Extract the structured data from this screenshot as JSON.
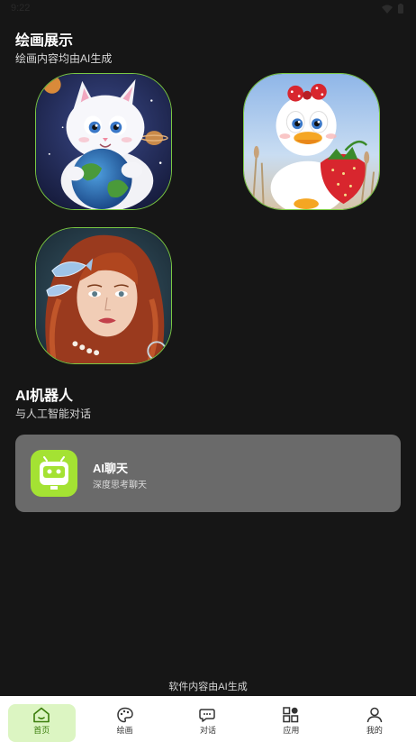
{
  "status": {
    "time": "9:22"
  },
  "gallery": {
    "title": "绘画展示",
    "subtitle": "绘画内容均由AI生成",
    "items": [
      {
        "icon": "cat-with-globe-artwork"
      },
      {
        "icon": "duck-with-strawberry-artwork"
      },
      {
        "icon": "red-haired-woman-artwork"
      }
    ]
  },
  "robot": {
    "title": "AI机器人",
    "subtitle": "与人工智能对话",
    "card": {
      "title": "AI聊天",
      "subtitle": "深度思考聊天",
      "icon": "robot-icon"
    }
  },
  "footer": {
    "note": "软件内容由AI生成"
  },
  "tabs": [
    {
      "label": "首页",
      "icon": "home-icon",
      "active": true
    },
    {
      "label": "绘画",
      "icon": "palette-icon",
      "active": false
    },
    {
      "label": "对话",
      "icon": "chat-bubbles-icon",
      "active": false
    },
    {
      "label": "应用",
      "icon": "apps-grid-icon",
      "active": false
    },
    {
      "label": "我的",
      "icon": "user-icon",
      "active": false
    }
  ],
  "colors": {
    "background": "#161616",
    "accent": "#a4e233",
    "card": "#6a6a6a",
    "active_tab_bg": "#dcf5c2"
  }
}
